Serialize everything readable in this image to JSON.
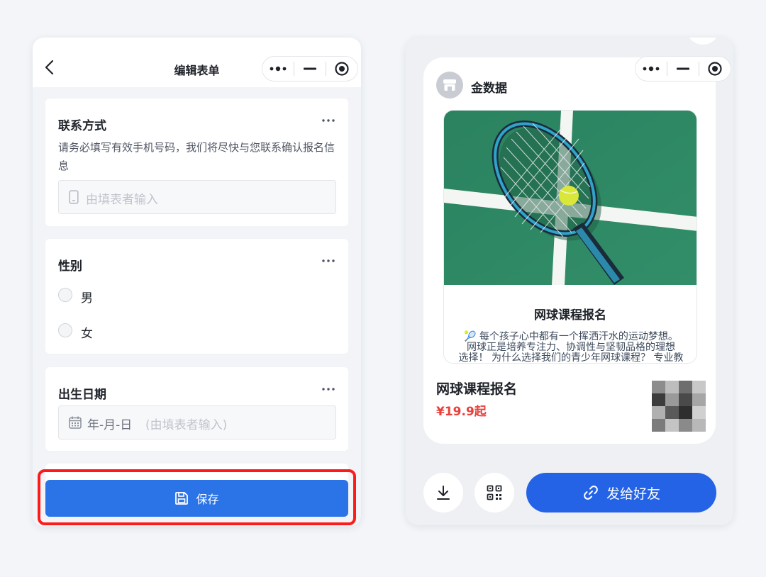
{
  "left": {
    "title": "编辑表单",
    "contact": {
      "title": "联系方式",
      "description": "请务必填写有效手机号码，我们将尽快与您联系确认报名信息",
      "placeholder": "由填表者输入"
    },
    "gender": {
      "title": "性别",
      "options": [
        "男",
        "女"
      ]
    },
    "birth": {
      "title": "出生日期",
      "date_format": "年-月-日",
      "placeholder": "(由填表者输入)"
    },
    "save_label": "保存"
  },
  "right": {
    "brand": "金数据",
    "card_title": "网球课程报名",
    "card_desc_lines": [
      "🎾 每个孩子心中都有一个挥洒汗水的运动梦想。",
      "网球正是培养专注力、协调性与坚韧品格的理想",
      "选择！ 为什么选择我们的青少年网球课程？ 专业教"
    ],
    "product_name": "网球课程报名",
    "price": "¥19.9起",
    "send_label": "发给好友"
  },
  "colors": {
    "primary": "#2b74e8",
    "send": "#2463e6",
    "price": "#e8413b",
    "highlight": "#ff1a1a",
    "court": "#2f8a66"
  },
  "icons": [
    "back-icon",
    "more-icon",
    "minimize-icon",
    "record-icon",
    "phone-icon",
    "calendar-icon",
    "save-icon",
    "download-icon",
    "qrcode-icon",
    "link-icon"
  ]
}
